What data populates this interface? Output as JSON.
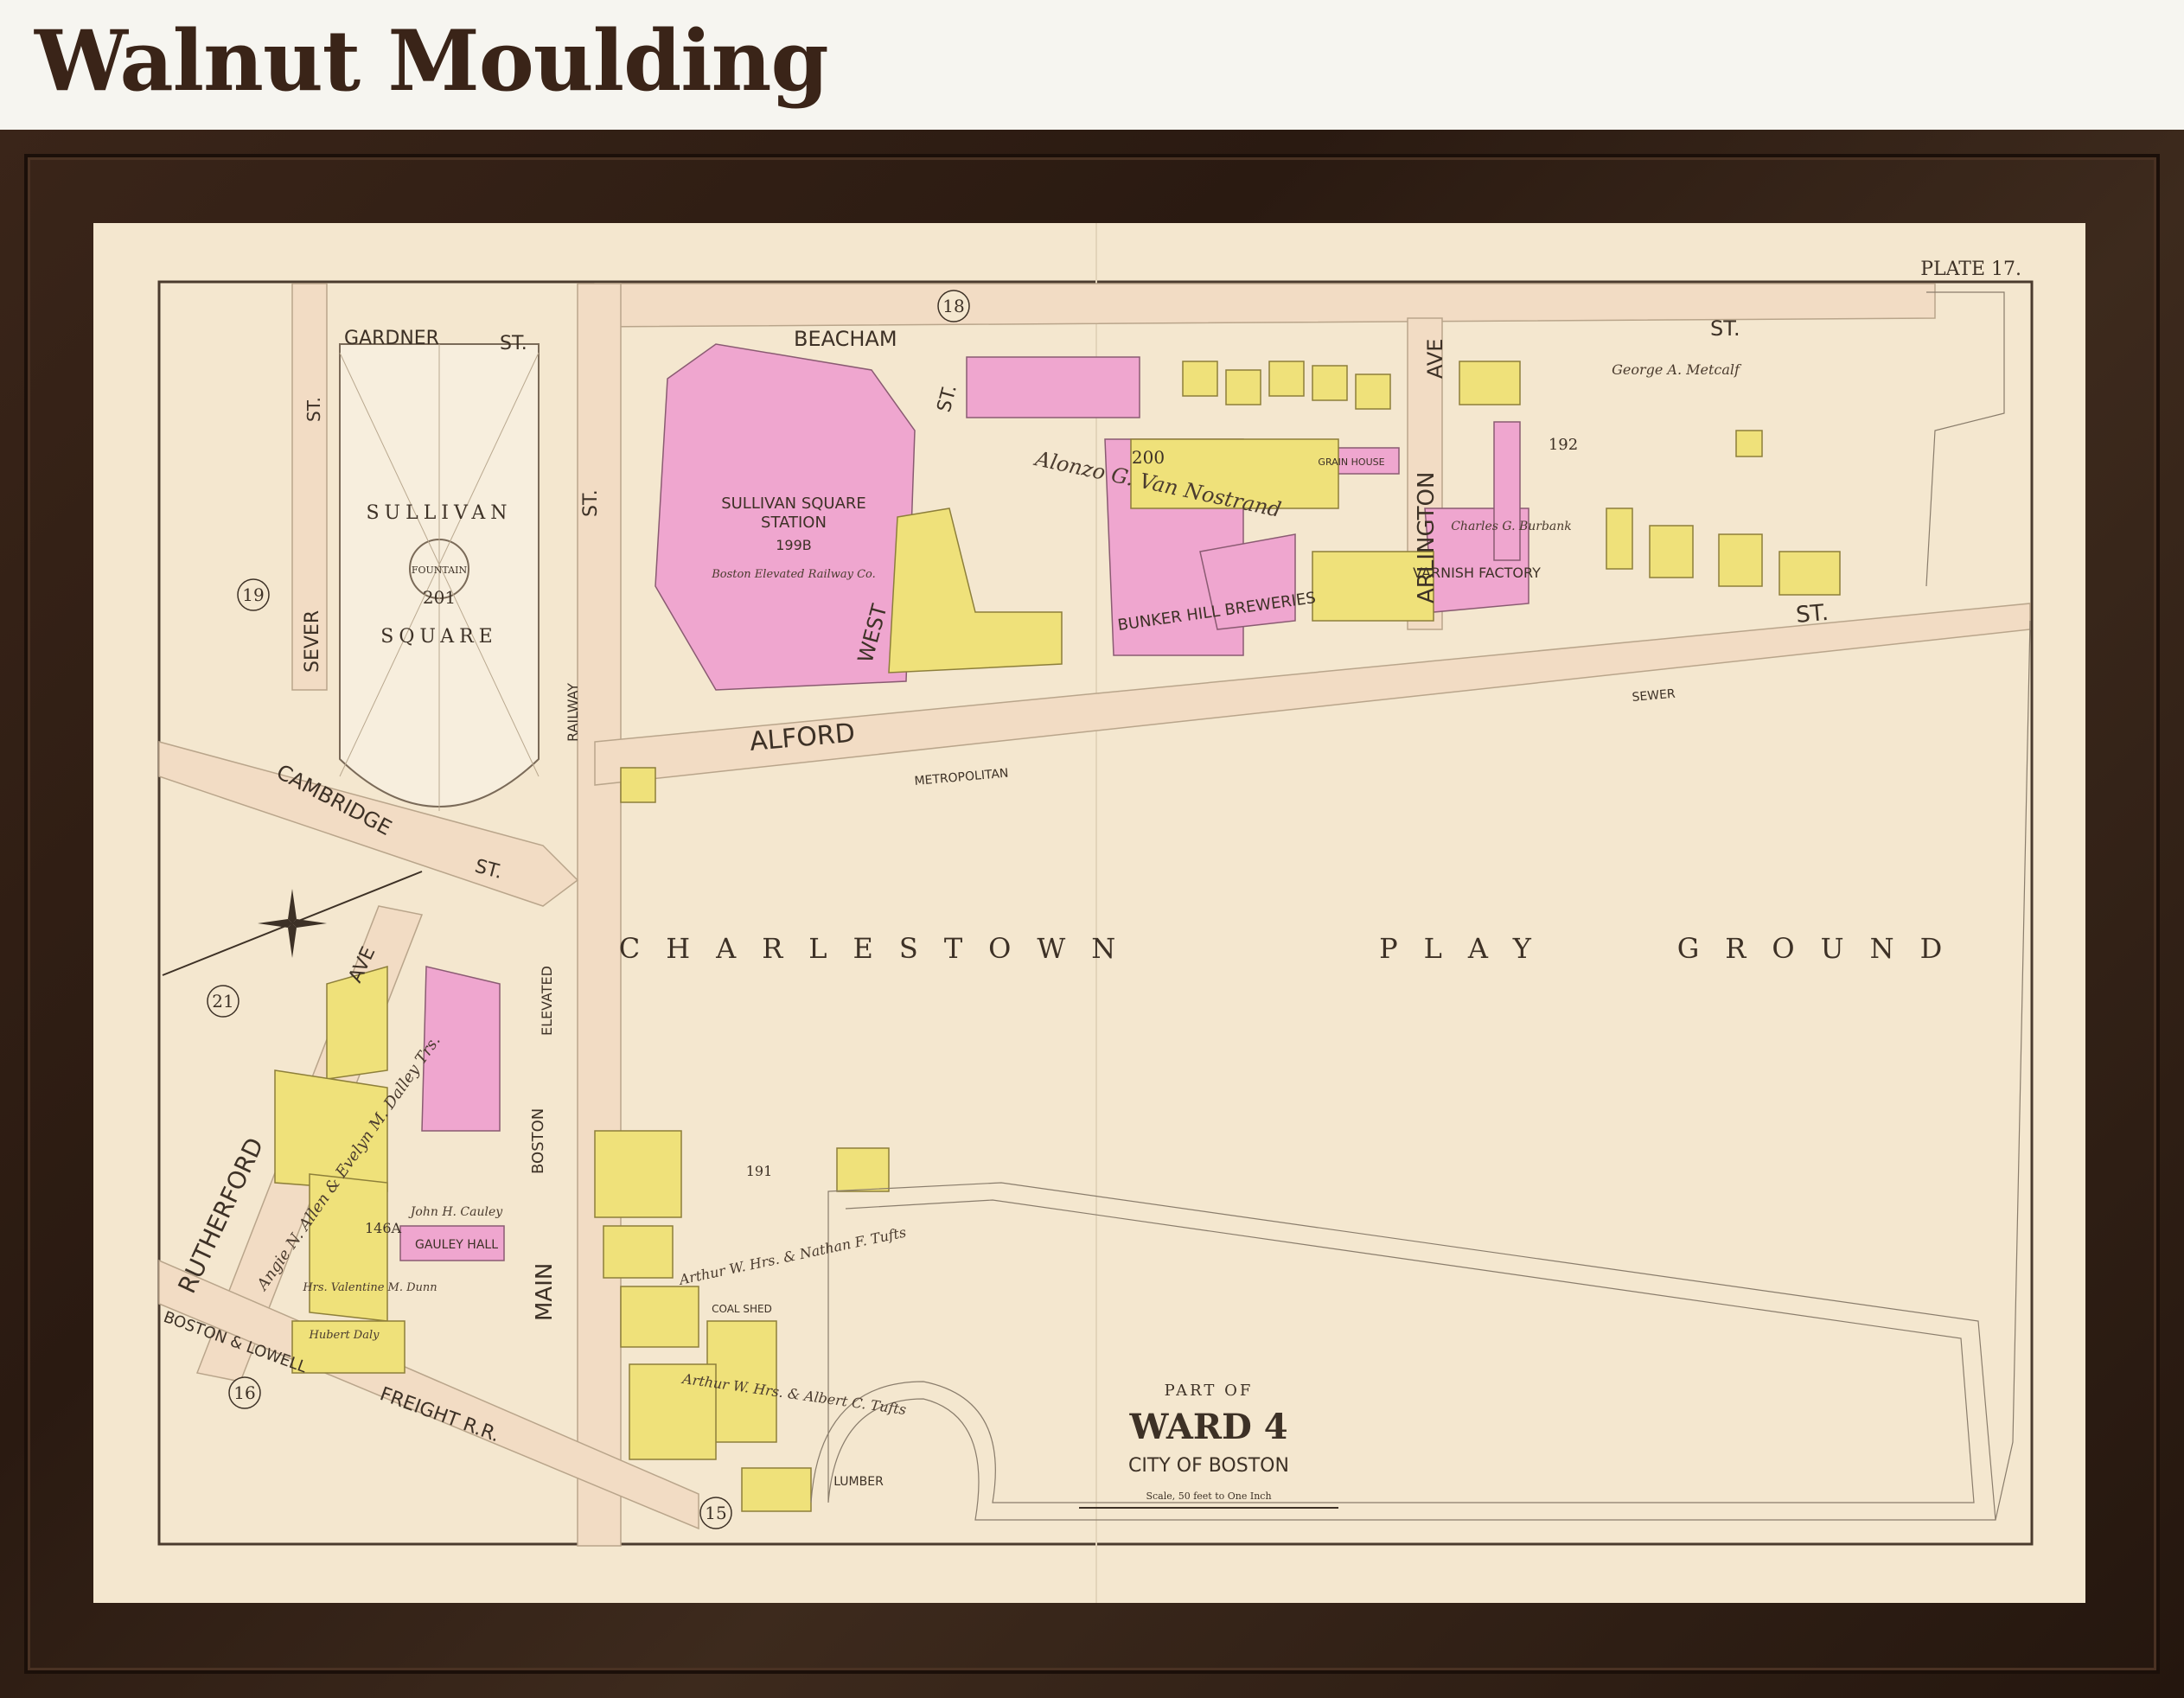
{
  "heading": "Walnut Moulding",
  "map": {
    "plate": "PLATE 17.",
    "title_part_of": "PART OF",
    "title_ward": "WARD 4",
    "title_city": "CITY OF BOSTON",
    "scale_text": "Scale, 50 feet to One Inch",
    "colors": {
      "paper": "#f4e7cf",
      "pink_building": "#efa6cf",
      "yellow_building": "#efe17a",
      "street": "#f2dcc4",
      "ink": "#3d3126"
    },
    "streets": [
      {
        "key": "gardner",
        "text": "GARDNER"
      },
      {
        "key": "gardner_st",
        "text": "ST."
      },
      {
        "key": "beacham",
        "text": "BEACHAM"
      },
      {
        "key": "beacham_st",
        "text": "ST."
      },
      {
        "key": "sever",
        "text": "SEVER"
      },
      {
        "key": "sever_st",
        "text": "ST."
      },
      {
        "key": "main_st",
        "text": "ST."
      },
      {
        "key": "west",
        "text": "WEST"
      },
      {
        "key": "west_st",
        "text": "ST."
      },
      {
        "key": "alford",
        "text": "ALFORD"
      },
      {
        "key": "arlington",
        "text": "ARLINGTON"
      },
      {
        "key": "arlington_ave",
        "text": "AVE"
      },
      {
        "key": "cambridge",
        "text": "CAMBRIDGE"
      },
      {
        "key": "cambridge_st",
        "text": "ST."
      },
      {
        "key": "rutherford",
        "text": "RUTHERFORD"
      },
      {
        "key": "rutherford_ave",
        "text": "AVE"
      },
      {
        "key": "main",
        "text": "MAIN"
      },
      {
        "key": "boston",
        "text": "BOSTON"
      },
      {
        "key": "elevated",
        "text": "ELEVATED"
      },
      {
        "key": "railway",
        "text": "RAILWAY"
      },
      {
        "key": "metropolitan",
        "text": "METROPOLITAN"
      },
      {
        "key": "sewer",
        "text": "SEWER"
      },
      {
        "key": "alford_st",
        "text": "ST."
      },
      {
        "key": "boston_lowell",
        "text": "BOSTON & LOWELL"
      },
      {
        "key": "freight",
        "text": "FREIGHT R.R."
      }
    ],
    "places": {
      "sullivan": "SULLIVAN",
      "square": "SQUARE",
      "fountain": "FOUNTAIN",
      "station_line1": "SULLIVAN SQUARE",
      "station_line2": "STATION",
      "station_owner": "Boston Elevated Railway Co.",
      "breweries": "BUNKER HILL BREWERIES",
      "grain_house": "GRAIN HOUSE",
      "varnish_factory": "VARNISH FACTORY",
      "gauley_hall": "GAULEY HALL",
      "coal_shed": "COAL SHED",
      "lumber": "LUMBER",
      "playground_1": "CHARLESTOWN",
      "playground_2": "PLAY",
      "playground_3": "GROUND",
      "van_nostrand": "Alonzo G. Van Nostrand",
      "metcalf": "George A. Metcalf",
      "burbank": "Charles G. Burbank",
      "tufts": "Arthur W. Hrs. & Nathan F. Tufts",
      "albert_tufts": "Arthur W. Hrs. & Albert C. Tufts",
      "dalley": "Angie N. Allen & Evelyn M. Dalley Trs.",
      "cauley": "John H. Cauley",
      "dunn": "Hrs. Valentine M. Dunn",
      "hubert": "Hubert Daly"
    },
    "lots": {
      "sullivan_sq": "201",
      "station": "199B",
      "brewery": "200",
      "east": "192",
      "south": "191",
      "southwest": "146A"
    },
    "plates": [
      "18",
      "19",
      "21",
      "16",
      "15"
    ]
  }
}
